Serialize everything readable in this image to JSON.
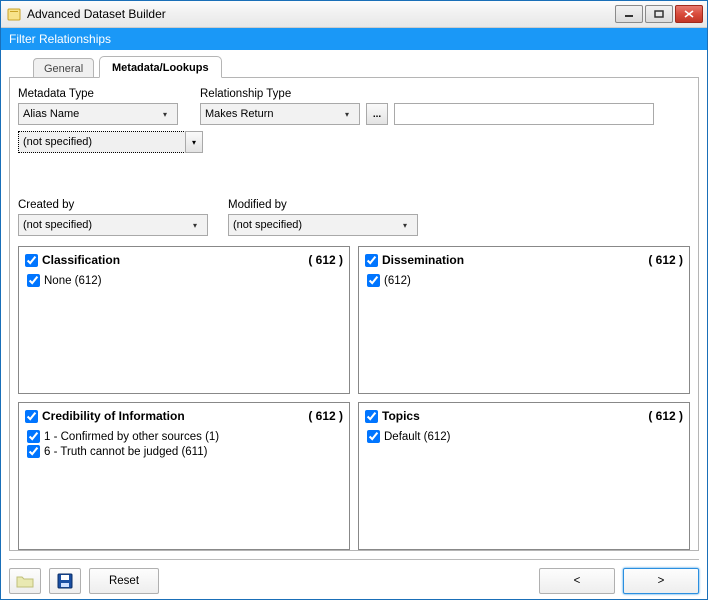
{
  "window": {
    "title": "Advanced Dataset Builder",
    "header_strip": "Filter Relationships"
  },
  "tabs": {
    "back": "General",
    "front": "Metadata/Lookups"
  },
  "metadata_type": {
    "label": "Metadata Type",
    "value": "Alias Name",
    "secondary_value": "(not specified)"
  },
  "relationship_type": {
    "label": "Relationship Type",
    "value": "Makes Return",
    "ellipsis": "...",
    "free_text": ""
  },
  "created_by": {
    "label": "Created by",
    "value": "(not specified)"
  },
  "modified_by": {
    "label": "Modified by",
    "value": "(not specified)"
  },
  "groups": {
    "classification": {
      "title": "Classification",
      "count": "( 612 )",
      "items": [
        {
          "label": "None (612)"
        }
      ]
    },
    "dissemination": {
      "title": "Dissemination",
      "count": "( 612 )",
      "items": [
        {
          "label": "(612)"
        }
      ]
    },
    "credibility": {
      "title": "Credibility of Information",
      "count": "( 612 )",
      "items": [
        {
          "label": "1 - Confirmed by other sources (1)"
        },
        {
          "label": "6 - Truth cannot be judged (611)"
        }
      ]
    },
    "topics": {
      "title": "Topics",
      "count": "( 612 )",
      "items": [
        {
          "label": "Default (612)"
        }
      ]
    }
  },
  "footer": {
    "reset": "Reset",
    "prev": "<",
    "next": ">"
  }
}
